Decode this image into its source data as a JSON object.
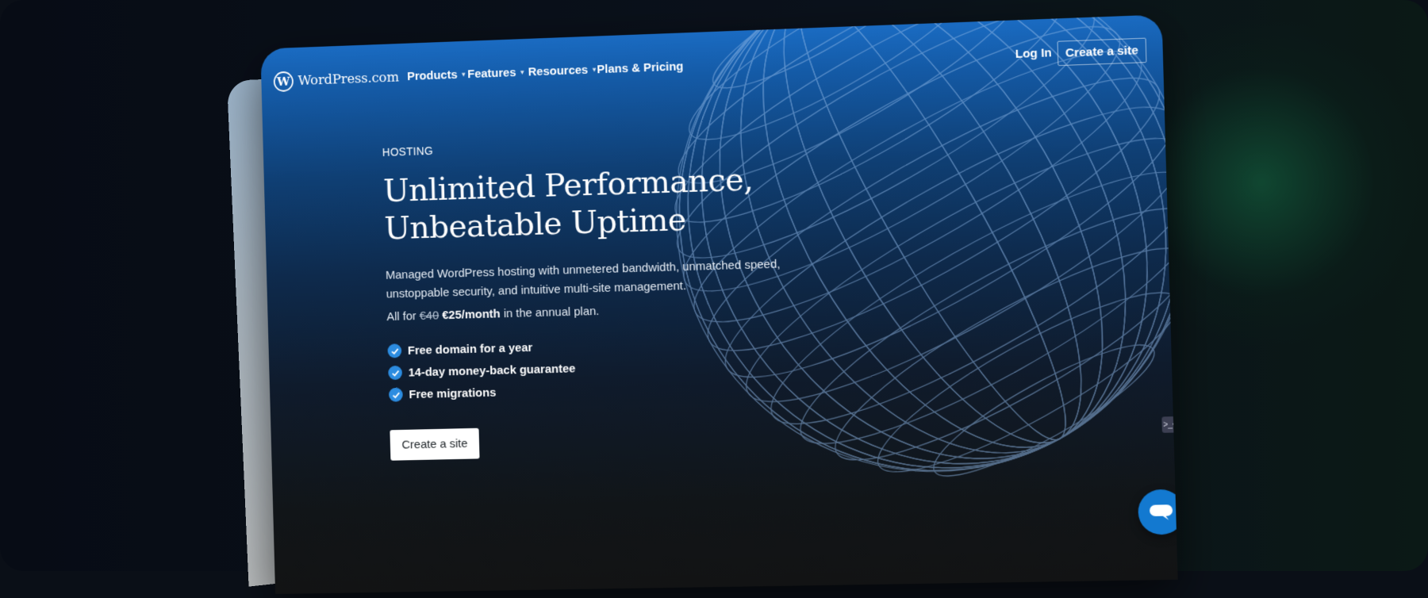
{
  "nav": {
    "logo_text": "WordPress.com",
    "items": [
      {
        "label": "Products",
        "has_caret": true
      },
      {
        "label": "Features",
        "has_caret": true
      },
      {
        "label": "Resources",
        "has_caret": true
      },
      {
        "label": "Plans & Pricing",
        "has_caret": false
      }
    ],
    "login_label": "Log In",
    "cta_label": "Create a site"
  },
  "hero": {
    "eyebrow": "HOSTING",
    "headline_line1": "Unlimited Performance,",
    "headline_line2": "Unbeatable Uptime",
    "subcopy": "Managed WordPress hosting with unmetered bandwidth, unmatched speed, unstoppable security, and intuitive multi-site management.",
    "price_prefix": "All for",
    "price_old": "€40",
    "price_new": "€25/month",
    "price_suffix": "in the annual plan.",
    "features": [
      "Free domain for a year",
      "14-day money-back guarantee",
      "Free migrations"
    ],
    "cta_label": "Create a site"
  },
  "widgets": {
    "mini_icon_glyph": ">_<",
    "chat_icon": "chat-bubble-icon"
  },
  "colors": {
    "accent": "#1379d0",
    "check": "#2c8ce0",
    "page_top": "#1a6bc2",
    "page_bottom": "#121314"
  }
}
